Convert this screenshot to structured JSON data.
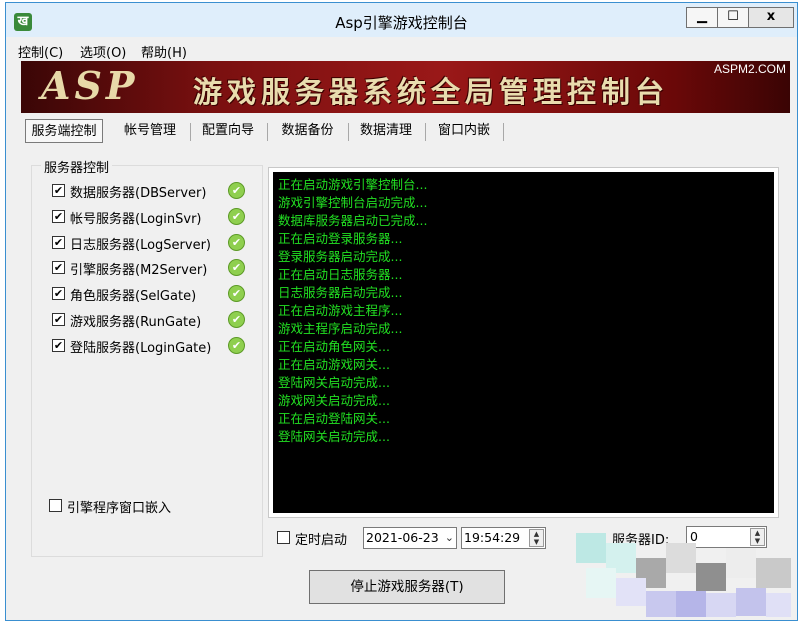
{
  "window": {
    "title": "Asp引擎游戏控制台",
    "app_icon": "ख",
    "controls": {
      "minimize": "▁",
      "maximize": "☐",
      "close": "x"
    }
  },
  "menu": [
    "控制(C)",
    "选项(O)",
    "帮助(H)"
  ],
  "banner": {
    "logo": "ASP",
    "title": "游戏服务器系统全局管理控制台",
    "corner": "ASPM2.COM"
  },
  "tabs": [
    "服务端控制",
    "帐号管理",
    "配置向导",
    "数据备份",
    "数据清理",
    "窗口内嵌"
  ],
  "server_group": {
    "title": "服务器控制",
    "servers": [
      {
        "label": "数据服务器(DBServer)",
        "checked": true
      },
      {
        "label": "帐号服务器(LoginSvr)",
        "checked": true
      },
      {
        "label": "日志服务器(LogServer)",
        "checked": true
      },
      {
        "label": "引擎服务器(M2Server)",
        "checked": true
      },
      {
        "label": "角色服务器(SelGate)",
        "checked": true
      },
      {
        "label": "游戏服务器(RunGate)",
        "checked": true
      },
      {
        "label": "登陆服务器(LoginGate)",
        "checked": true
      }
    ],
    "embed_label": "引擎程序窗口嵌入"
  },
  "console_lines": [
    "正在启动游戏引擎控制台...",
    "游戏引擎控制台启动完成...",
    "数据库服务器启动已完成...",
    "正在启动登录服务器...",
    "登录服务器启动完成...",
    "正在启动日志服务器...",
    "日志服务器启动完成...",
    "正在启动游戏主程序...",
    "游戏主程序启动完成...",
    "正在启动角色网关...",
    "正在启动游戏网关...",
    "登陆网关启动完成...",
    "游戏网关启动完成...",
    "正在启动登陆网关...",
    "登陆网关启动完成..."
  ],
  "timer": {
    "label": "定时启动",
    "date": "2021-06-23",
    "time": "19:54:29"
  },
  "server_id": {
    "label": "服务器ID:",
    "value": "0"
  },
  "stop_button": "停止游戏服务器(T)",
  "colors": {
    "console_bg": "#000000",
    "console_text": "#22e022",
    "ok_green": "#8fcf4f"
  },
  "icons": {
    "check": "✔",
    "dropdown": "⌄"
  }
}
